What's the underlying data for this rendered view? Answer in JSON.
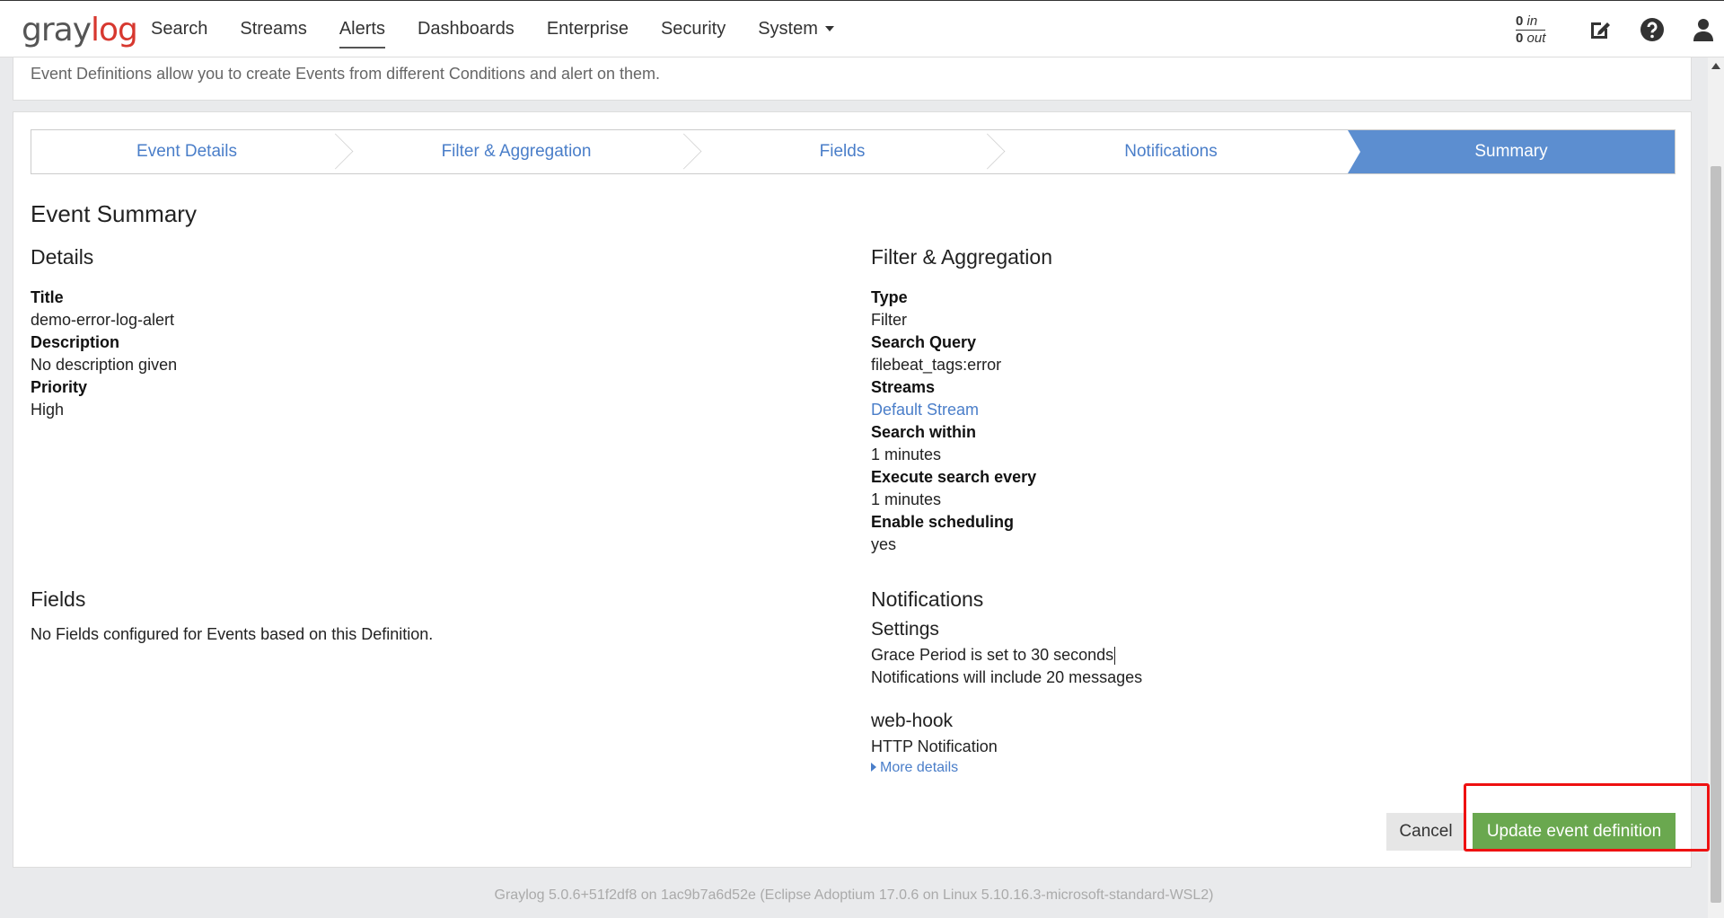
{
  "app": {
    "logo_prefix": "gray",
    "logo_accent": "log",
    "nav": [
      "Search",
      "Streams",
      "Alerts",
      "Dashboards",
      "Enterprise",
      "Security",
      "System"
    ],
    "active_nav": "Alerts",
    "throughput": {
      "in_count": "0",
      "in_label": "in",
      "out_count": "0",
      "out_label": "out"
    }
  },
  "header": {
    "description": "Event Definitions allow you to create Events from different Conditions and alert on them."
  },
  "steps": [
    "Event Details",
    "Filter & Aggregation",
    "Fields",
    "Notifications",
    "Summary"
  ],
  "active_step": "Summary",
  "summary": {
    "title": "Event Summary",
    "details": {
      "heading": "Details",
      "title_label": "Title",
      "title_value": "demo-error-log-alert",
      "description_label": "Description",
      "description_value": "No description given",
      "priority_label": "Priority",
      "priority_value": "High"
    },
    "filter": {
      "heading": "Filter & Aggregation",
      "type_label": "Type",
      "type_value": "Filter",
      "query_label": "Search Query",
      "query_value": "filebeat_tags:error",
      "streams_label": "Streams",
      "streams_value": "Default Stream",
      "within_label": "Search within",
      "within_value": "1 minutes",
      "every_label": "Execute search every",
      "every_value": "1 minutes",
      "scheduling_label": "Enable scheduling",
      "scheduling_value": "yes"
    },
    "fields": {
      "heading": "Fields",
      "message": "No Fields configured for Events based on this Definition."
    },
    "notifications": {
      "heading": "Notifications",
      "settings_heading": "Settings",
      "grace": "Grace Period is set to 30 seconds",
      "include": "Notifications will include 20 messages",
      "name": "web-hook",
      "type": "HTTP Notification",
      "more": "More details"
    }
  },
  "actions": {
    "cancel": "Cancel",
    "update": "Update event definition"
  },
  "footer": "Graylog 5.0.6+51f2df8 on 1ac9b7a6d52e (Eclipse Adoptium 17.0.6 on Linux 5.10.16.3-microsoft-standard-WSL2)",
  "colors": {
    "accent": "#5c8ed0",
    "link": "#4a7ec9",
    "success": "#6aa84f",
    "logo_red": "#d7382f",
    "highlight": "#ee1111"
  },
  "icons": [
    "edit-icon",
    "help-icon",
    "user-icon",
    "caret-down-icon",
    "scroll-up-icon",
    "triangle-right-icon"
  ]
}
